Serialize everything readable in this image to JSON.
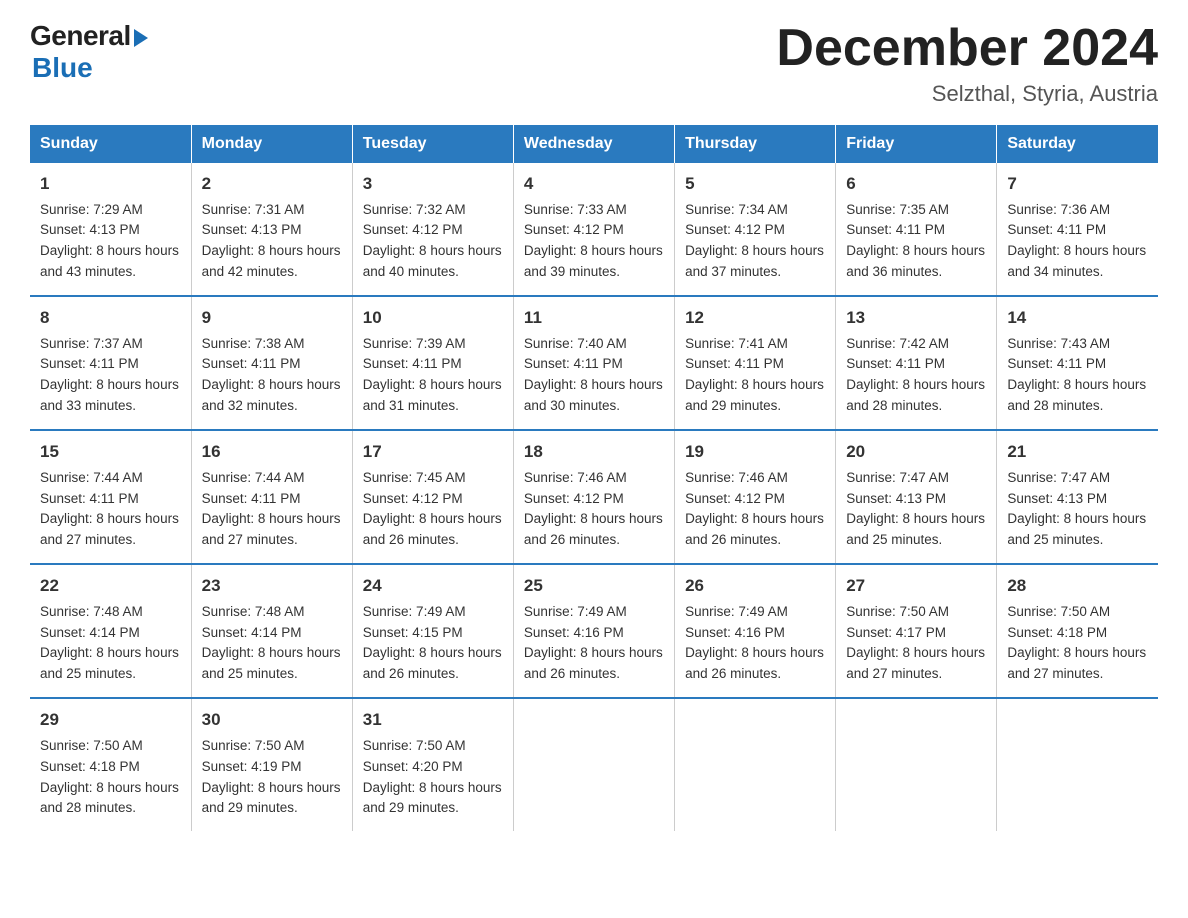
{
  "logo": {
    "general": "General",
    "blue": "Blue"
  },
  "header": {
    "month": "December 2024",
    "location": "Selzthal, Styria, Austria"
  },
  "days": [
    "Sunday",
    "Monday",
    "Tuesday",
    "Wednesday",
    "Thursday",
    "Friday",
    "Saturday"
  ],
  "weeks": [
    [
      {
        "day": "1",
        "sunrise": "7:29 AM",
        "sunset": "4:13 PM",
        "daylight": "8 hours and 43 minutes."
      },
      {
        "day": "2",
        "sunrise": "7:31 AM",
        "sunset": "4:13 PM",
        "daylight": "8 hours and 42 minutes."
      },
      {
        "day": "3",
        "sunrise": "7:32 AM",
        "sunset": "4:12 PM",
        "daylight": "8 hours and 40 minutes."
      },
      {
        "day": "4",
        "sunrise": "7:33 AM",
        "sunset": "4:12 PM",
        "daylight": "8 hours and 39 minutes."
      },
      {
        "day": "5",
        "sunrise": "7:34 AM",
        "sunset": "4:12 PM",
        "daylight": "8 hours and 37 minutes."
      },
      {
        "day": "6",
        "sunrise": "7:35 AM",
        "sunset": "4:11 PM",
        "daylight": "8 hours and 36 minutes."
      },
      {
        "day": "7",
        "sunrise": "7:36 AM",
        "sunset": "4:11 PM",
        "daylight": "8 hours and 34 minutes."
      }
    ],
    [
      {
        "day": "8",
        "sunrise": "7:37 AM",
        "sunset": "4:11 PM",
        "daylight": "8 hours and 33 minutes."
      },
      {
        "day": "9",
        "sunrise": "7:38 AM",
        "sunset": "4:11 PM",
        "daylight": "8 hours and 32 minutes."
      },
      {
        "day": "10",
        "sunrise": "7:39 AM",
        "sunset": "4:11 PM",
        "daylight": "8 hours and 31 minutes."
      },
      {
        "day": "11",
        "sunrise": "7:40 AM",
        "sunset": "4:11 PM",
        "daylight": "8 hours and 30 minutes."
      },
      {
        "day": "12",
        "sunrise": "7:41 AM",
        "sunset": "4:11 PM",
        "daylight": "8 hours and 29 minutes."
      },
      {
        "day": "13",
        "sunrise": "7:42 AM",
        "sunset": "4:11 PM",
        "daylight": "8 hours and 28 minutes."
      },
      {
        "day": "14",
        "sunrise": "7:43 AM",
        "sunset": "4:11 PM",
        "daylight": "8 hours and 28 minutes."
      }
    ],
    [
      {
        "day": "15",
        "sunrise": "7:44 AM",
        "sunset": "4:11 PM",
        "daylight": "8 hours and 27 minutes."
      },
      {
        "day": "16",
        "sunrise": "7:44 AM",
        "sunset": "4:11 PM",
        "daylight": "8 hours and 27 minutes."
      },
      {
        "day": "17",
        "sunrise": "7:45 AM",
        "sunset": "4:12 PM",
        "daylight": "8 hours and 26 minutes."
      },
      {
        "day": "18",
        "sunrise": "7:46 AM",
        "sunset": "4:12 PM",
        "daylight": "8 hours and 26 minutes."
      },
      {
        "day": "19",
        "sunrise": "7:46 AM",
        "sunset": "4:12 PM",
        "daylight": "8 hours and 26 minutes."
      },
      {
        "day": "20",
        "sunrise": "7:47 AM",
        "sunset": "4:13 PM",
        "daylight": "8 hours and 25 minutes."
      },
      {
        "day": "21",
        "sunrise": "7:47 AM",
        "sunset": "4:13 PM",
        "daylight": "8 hours and 25 minutes."
      }
    ],
    [
      {
        "day": "22",
        "sunrise": "7:48 AM",
        "sunset": "4:14 PM",
        "daylight": "8 hours and 25 minutes."
      },
      {
        "day": "23",
        "sunrise": "7:48 AM",
        "sunset": "4:14 PM",
        "daylight": "8 hours and 25 minutes."
      },
      {
        "day": "24",
        "sunrise": "7:49 AM",
        "sunset": "4:15 PM",
        "daylight": "8 hours and 26 minutes."
      },
      {
        "day": "25",
        "sunrise": "7:49 AM",
        "sunset": "4:16 PM",
        "daylight": "8 hours and 26 minutes."
      },
      {
        "day": "26",
        "sunrise": "7:49 AM",
        "sunset": "4:16 PM",
        "daylight": "8 hours and 26 minutes."
      },
      {
        "day": "27",
        "sunrise": "7:50 AM",
        "sunset": "4:17 PM",
        "daylight": "8 hours and 27 minutes."
      },
      {
        "day": "28",
        "sunrise": "7:50 AM",
        "sunset": "4:18 PM",
        "daylight": "8 hours and 27 minutes."
      }
    ],
    [
      {
        "day": "29",
        "sunrise": "7:50 AM",
        "sunset": "4:18 PM",
        "daylight": "8 hours and 28 minutes."
      },
      {
        "day": "30",
        "sunrise": "7:50 AM",
        "sunset": "4:19 PM",
        "daylight": "8 hours and 29 minutes."
      },
      {
        "day": "31",
        "sunrise": "7:50 AM",
        "sunset": "4:20 PM",
        "daylight": "8 hours and 29 minutes."
      },
      null,
      null,
      null,
      null
    ]
  ],
  "labels": {
    "sunrise": "Sunrise: ",
    "sunset": "Sunset: ",
    "daylight": "Daylight: "
  }
}
